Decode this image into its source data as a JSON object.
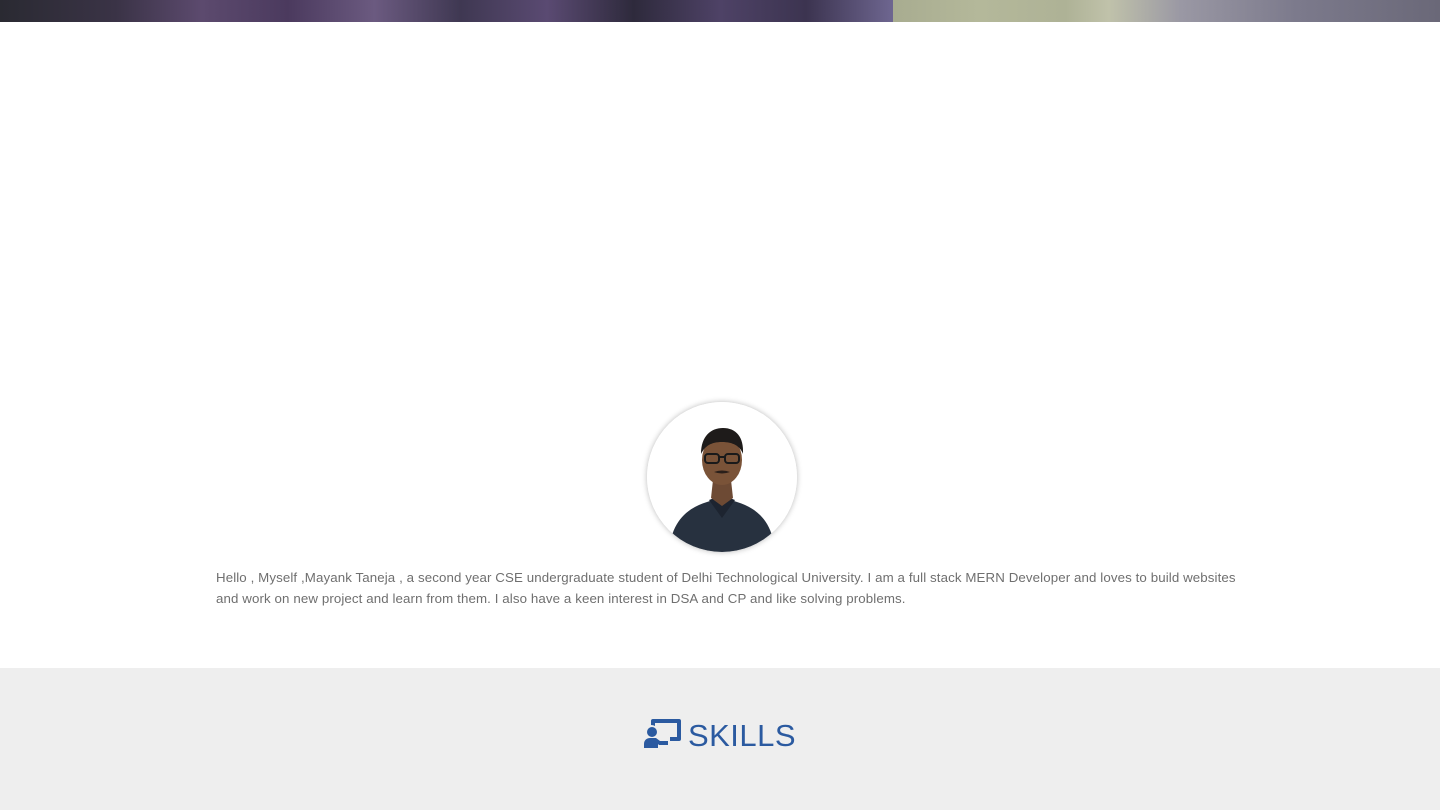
{
  "about": {
    "bio": "Hello , Myself ,Mayank Taneja , a second year CSE undergraduate student of Delhi Technological University. I am a full stack MERN Developer and loves to build websites and work on new project and learn from them. I also have a keen interest in DSA and CP and like solving problems."
  },
  "skills": {
    "heading": "SKILLS",
    "icon": "chalkboard-teacher-icon"
  },
  "colors": {
    "accent": "#2b5aa0",
    "skills_bg": "#eeeeee",
    "bio_text": "#6f6f6f"
  }
}
